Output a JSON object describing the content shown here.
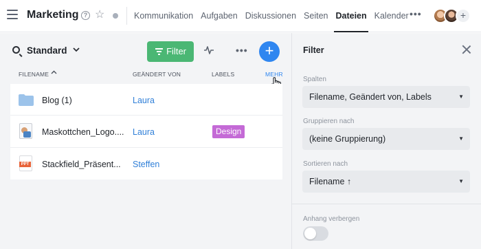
{
  "header": {
    "title": "Marketing",
    "nav": [
      "Kommunikation",
      "Aufgaben",
      "Diskussionen",
      "Seiten",
      "Dateien",
      "Kalender"
    ],
    "active_tab": "Dateien",
    "more": "•••",
    "add": "+"
  },
  "toolbar": {
    "view": "Standard",
    "filter_label": "Filter",
    "add": "+",
    "more": "•••"
  },
  "table": {
    "columns": {
      "filename": "FILENAME",
      "changed_by": "GEÄNDERT VON",
      "labels": "LABELS",
      "more": "MEHR"
    },
    "rows": [
      {
        "name": "Blog (1)",
        "user": "Laura",
        "label": "",
        "icon": "folder-icon"
      },
      {
        "name": "Maskottchen_Logo....",
        "user": "Laura",
        "label": "Design",
        "icon": "image-file-icon"
      },
      {
        "name": "Stackfield_Präsent...",
        "user": "Steffen",
        "label": "",
        "icon": "ppt-file-icon"
      }
    ],
    "label_color": "#c46ad6"
  },
  "filter_panel": {
    "title": "Filter",
    "columns_label": "Spalten",
    "columns_value": "Filename, Geändert von, Labels",
    "group_label": "Gruppieren nach",
    "group_value": "(keine Gruppierung)",
    "sort_label": "Sortieren nach",
    "sort_value": "Filename ↑",
    "hide_attachment_label": "Anhang verbergen",
    "hide_attachment_on": false
  },
  "colors": {
    "accent_blue": "#2f86f0",
    "filter_green": "#4bb774"
  }
}
